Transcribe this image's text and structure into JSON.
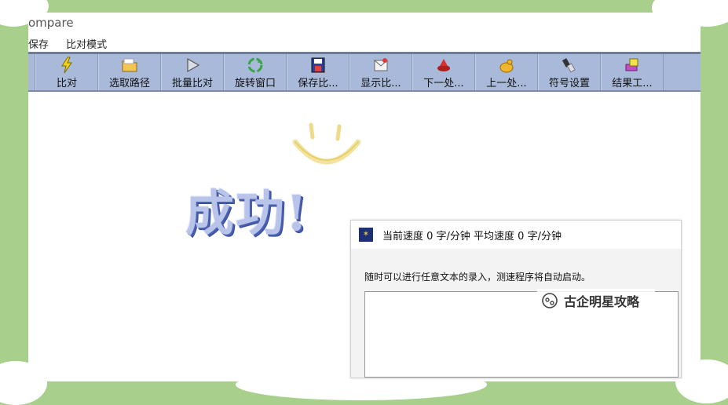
{
  "window": {
    "title": "ompare"
  },
  "menu": [
    "保存",
    "比对模式"
  ],
  "toolbar": {
    "buttons": [
      {
        "label": "比对",
        "icon": "lightning-icon"
      },
      {
        "label": "选取路径",
        "icon": "folder-icon"
      },
      {
        "label": "批量比对",
        "icon": "play-icon"
      },
      {
        "label": "旋转窗口",
        "icon": "recycle-icon"
      },
      {
        "label": "保存比...",
        "icon": "save-icon"
      },
      {
        "label": "显示比...",
        "icon": "display-icon"
      },
      {
        "label": "下一处...",
        "icon": "next-icon"
      },
      {
        "label": "上一处...",
        "icon": "prev-icon"
      },
      {
        "label": "符号设置",
        "icon": "symbol-settings-icon"
      },
      {
        "label": "结果工...",
        "icon": "result-tools-icon"
      }
    ]
  },
  "main": {
    "success_text": "成功!"
  },
  "dialog": {
    "title": "当前速度 0 字/分钟  平均速度 0 字/分钟",
    "hint": "随时可以进行任意文本的录入，测速程序将自动启动。"
  },
  "watermark": {
    "text": "古企明星攻略"
  },
  "colors": {
    "background": "#a9cf8c",
    "toolbar": "#a9b9d9",
    "success": "#b9c4ea"
  }
}
